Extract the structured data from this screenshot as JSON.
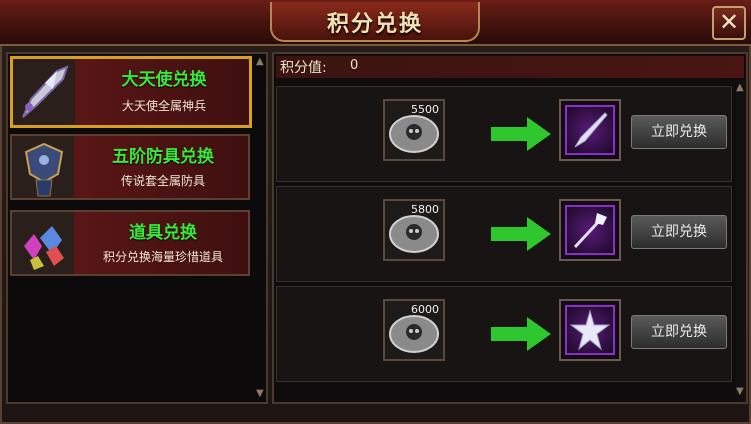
{
  "window": {
    "title": "积分兑换"
  },
  "categories": [
    {
      "title": "大天使兑换",
      "subtitle": "大天使全属神兵",
      "selected": true,
      "icon": "sword-icon"
    },
    {
      "title": "五阶防具兑换",
      "subtitle": "传说套全属防具",
      "selected": false,
      "icon": "armor-icon"
    },
    {
      "title": "道具兑换",
      "subtitle": "积分兑换海量珍惜道具",
      "selected": false,
      "icon": "gems-icon"
    }
  ],
  "points": {
    "label": "积分值:",
    "value": "0"
  },
  "items": [
    {
      "cost": "5500",
      "button_label": "立即兑换",
      "reward_icon": "sword-icon"
    },
    {
      "cost": "5800",
      "button_label": "立即兑换",
      "reward_icon": "staff-icon"
    },
    {
      "cost": "6000",
      "button_label": "立即兑换",
      "reward_icon": "star-mace-icon"
    }
  ],
  "colors": {
    "category_title": "#3ae83a",
    "selected_border": "#d8a020",
    "arrow": "#2ec82e",
    "reward_border": "#8a30c8"
  }
}
